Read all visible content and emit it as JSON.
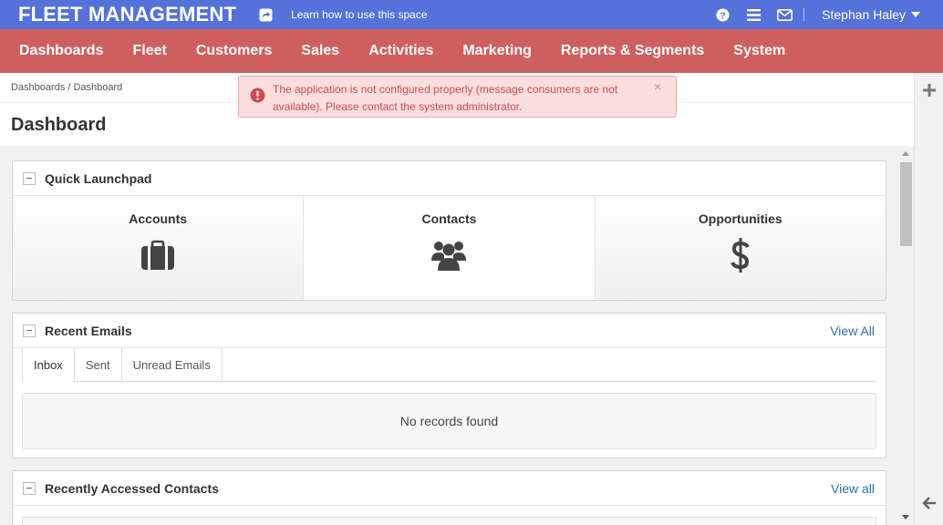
{
  "topbar": {
    "brand": "FLEET MANAGEMENT",
    "learn_link": "Learn how to use this space",
    "user_name": "Stephan Haley",
    "icons": [
      "share-icon",
      "help-icon",
      "menu-icon",
      "envelope-icon",
      "caret-down-icon"
    ]
  },
  "nav": {
    "items": [
      {
        "label": "Dashboards"
      },
      {
        "label": "Fleet"
      },
      {
        "label": "Customers"
      },
      {
        "label": "Sales"
      },
      {
        "label": "Activities"
      },
      {
        "label": "Marketing"
      },
      {
        "label": "Reports & Segments"
      },
      {
        "label": "System"
      }
    ]
  },
  "breadcrumb": "Dashboards / Dashboard",
  "page_title": "Dashboard",
  "alert": {
    "message": "The application is not configured properly (message consumers are not available). Please contact the system administrator.",
    "close_label": "×"
  },
  "quick_launchpad": {
    "title": "Quick Launchpad",
    "tiles": [
      {
        "label": "Accounts",
        "icon": "briefcase-icon"
      },
      {
        "label": "Contacts",
        "icon": "users-icon"
      },
      {
        "label": "Opportunities",
        "icon": "dollar-icon"
      }
    ]
  },
  "recent_emails": {
    "title": "Recent Emails",
    "view_all": "View All",
    "tabs": [
      {
        "label": "Inbox"
      },
      {
        "label": "Sent"
      },
      {
        "label": "Unread Emails"
      }
    ],
    "empty_text": "No records found"
  },
  "recent_contacts": {
    "title": "Recently Accessed Contacts",
    "view_all": "View all"
  },
  "colors": {
    "topbar": "#5472d9",
    "nav": "#cf5f5f",
    "link": "#2e6fb0",
    "alert_bg": "#fcdede",
    "alert_text": "#cb4d4d"
  }
}
